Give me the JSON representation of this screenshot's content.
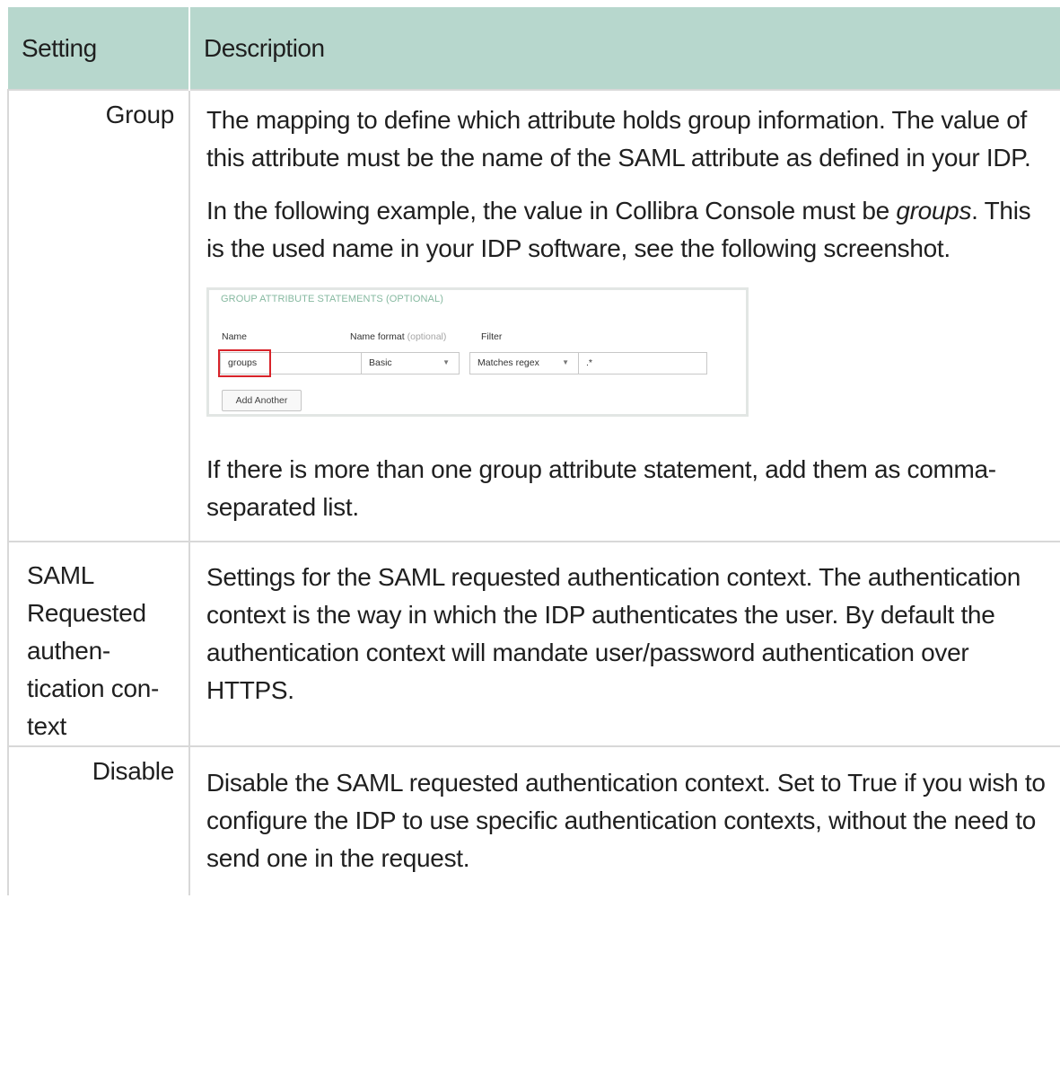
{
  "table": {
    "headers": {
      "setting": "Setting",
      "description": "Description"
    },
    "rows": {
      "group": {
        "setting": "Group",
        "para1": "The mapping to define which attribute holds group information. The value of this attribute must be the name of the SAML attribute as defined in your IDP.",
        "para2_before": "In the following example, the value in Collibra Console must be ",
        "para2_italic": "groups",
        "para2_after": ". This is the used name in your IDP software, see the following screenshot.",
        "para3": "If there is more than one group attribute statement, add them as comma-separated list."
      },
      "saml": {
        "setting": "SAML Requested authen­tication con­text",
        "description": "Settings for the SAML requested authentication context. The authen­tication context is the way in which the IDP authenticates the user. By default the authentication context will mandate user/password authen­tication over HTTPS."
      },
      "disable": {
        "setting": "Disable",
        "description": "Disable the SAML requested authentication context. Set to True if you wish to configure the IDP to use specific authentication contexts, without the need to send one in the request."
      }
    }
  },
  "embedded_screenshot": {
    "title": "GROUP ATTRIBUTE STATEMENTS (OPTIONAL)",
    "name_label": "Name",
    "name_format_label": "Name format",
    "name_format_optional": "(optional)",
    "filter_label": "Filter",
    "name_value": "groups",
    "name_format_value": "Basic",
    "filter_type_value": "Matches regex",
    "filter_value": ".*",
    "add_button": "Add Another",
    "highlight_color": "#d8232a",
    "title_color": "#86b9a0"
  },
  "colors": {
    "header_bg": "#b7d7cd",
    "border": "#d8d8d8"
  },
  "icons": {
    "dropdown": "caret-down-icon"
  }
}
